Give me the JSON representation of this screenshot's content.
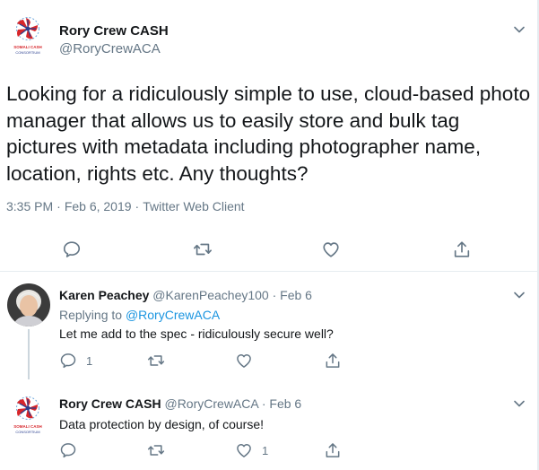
{
  "main_tweet": {
    "display_name": "Rory Crew CASH",
    "handle": "@RoryCrewACA",
    "text": "Looking for a ridiculously simple to use, cloud-based photo manager that allows us to easily store and bulk tag pictures with metadata including photographer name, location, rights etc. Any thoughts?",
    "time": "3:35 PM",
    "date": "Feb 6, 2019",
    "source": "Twitter Web Client",
    "separator": "·"
  },
  "logo": {
    "line1": "SOMALI CASH",
    "line2": "CONSORTIUM",
    "colors": {
      "red": "#d7262b",
      "blue": "#2a3f8f",
      "light_blue": "#6fa8dc"
    }
  },
  "replies": [
    {
      "display_name": "Karen Peachey",
      "handle": "@KarenPeachey100",
      "separator": "·",
      "date": "Feb 6",
      "replying_label": "Replying to",
      "replying_to": "@RoryCrewACA",
      "text": "Let me add to the spec -  ridiculously secure well?",
      "counts": {
        "reply": "1",
        "retweet": "",
        "like": ""
      }
    },
    {
      "display_name": "Rory Crew CASH",
      "handle": "@RoryCrewACA",
      "separator": "·",
      "date": "Feb 6",
      "text": "Data protection by design, of course!",
      "counts": {
        "reply": "",
        "retweet": "",
        "like": "1"
      }
    }
  ],
  "icons": {
    "reply": "reply-icon",
    "retweet": "retweet-icon",
    "like": "heart-icon",
    "share": "share-icon",
    "menu": "chevron-down-icon"
  },
  "colors": {
    "text": "#14171a",
    "secondary": "#657786",
    "link": "#1b95e0",
    "divider": "#e6ecf0",
    "icon": "#657786"
  }
}
